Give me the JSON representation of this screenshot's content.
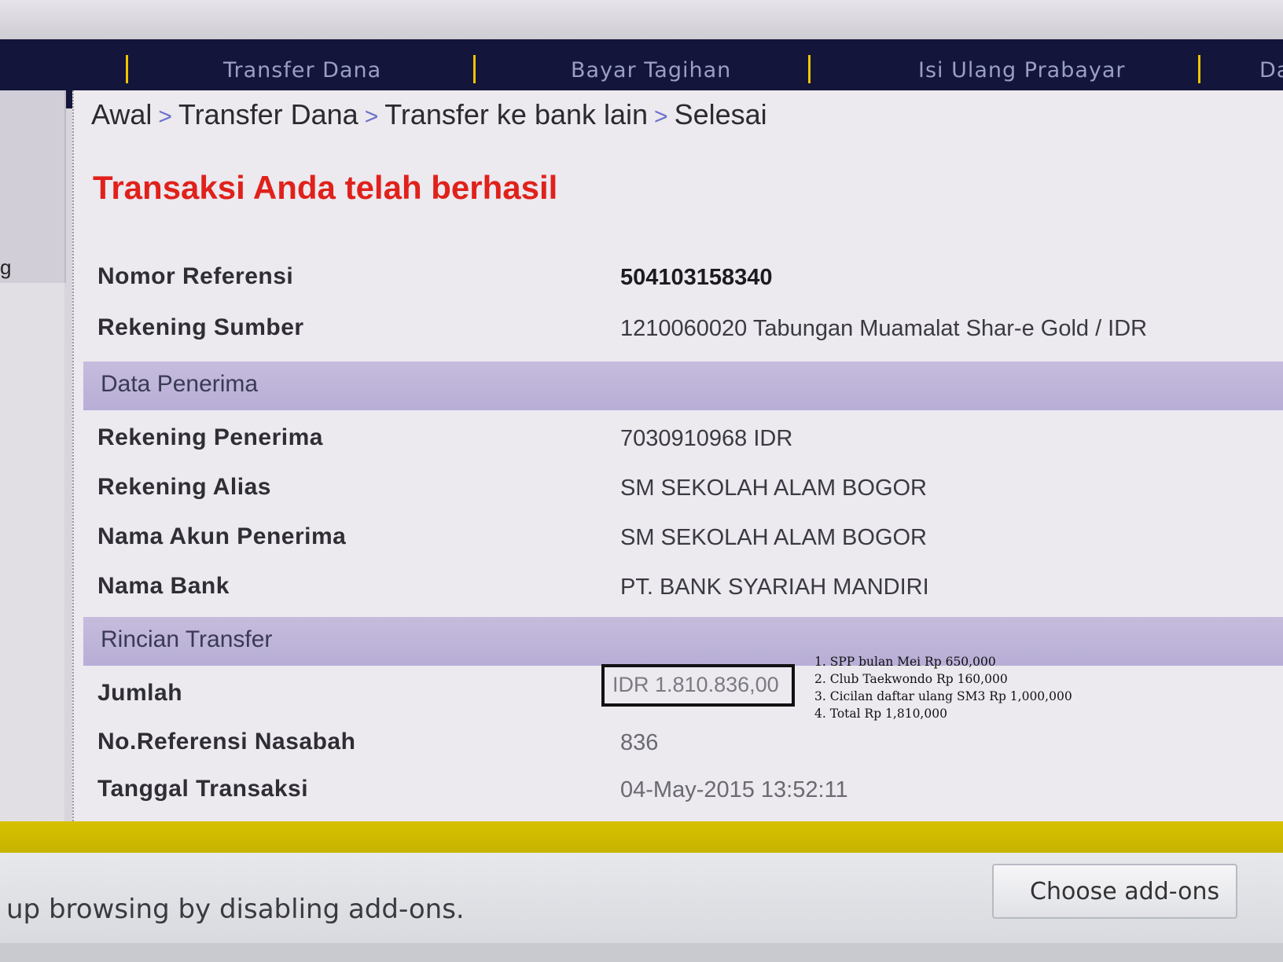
{
  "nav": {
    "items": [
      "Transfer Dana",
      "Bayar Tagihan",
      "Isi Ulang Prabayar",
      "Da"
    ]
  },
  "left_panel": {
    "glyph": "g"
  },
  "breadcrumb": {
    "items": [
      "Awal",
      "Transfer Dana",
      "Transfer ke bank lain",
      "Selesai"
    ],
    "separator": ">"
  },
  "status_message": "Transaksi Anda telah berhasil",
  "details": [
    {
      "label": "Nomor Referensi",
      "value": "504103158340"
    },
    {
      "label": "Rekening Sumber",
      "value": "1210060020 Tabungan Muamalat Shar-e Gold / IDR"
    }
  ],
  "recipient_section": {
    "title": "Data Penerima",
    "rows": [
      {
        "label": "Rekening Penerima",
        "value": "7030910968 IDR"
      },
      {
        "label": "Rekening Alias",
        "value": "SM SEKOLAH ALAM BOGOR"
      },
      {
        "label": "Nama Akun Penerima",
        "value": "SM SEKOLAH ALAM BOGOR"
      },
      {
        "label": "Nama Bank",
        "value": "PT. BANK SYARIAH MANDIRI"
      }
    ]
  },
  "transfer_section": {
    "title": "Rincian Transfer",
    "rows": [
      {
        "label": "Jumlah",
        "value": "IDR 1.810.836,00"
      },
      {
        "label": "No.Referensi Nasabah",
        "value": "836"
      },
      {
        "label": "Tanggal Transaksi",
        "value": "04-May-2015 13:52:11"
      }
    ]
  },
  "annotation": {
    "lines": [
      "1. SPP bulan Mei   Rp 650,000",
      "2. Club Taekwondo Rp 160,000",
      "3. Cicilan daftar ulang SM3 Rp 1,000,000",
      "4. Total Rp 1,810,000"
    ]
  },
  "notification_bar": {
    "message": "up browsing by disabling add-ons.",
    "button_label": "Choose add-ons"
  },
  "colors": {
    "nav_bg": "#14153a",
    "nav_separator": "#f0c400",
    "success_red": "#e0211b",
    "section_purple": "#bfb5da",
    "yellow_bar": "#d0bb00"
  }
}
